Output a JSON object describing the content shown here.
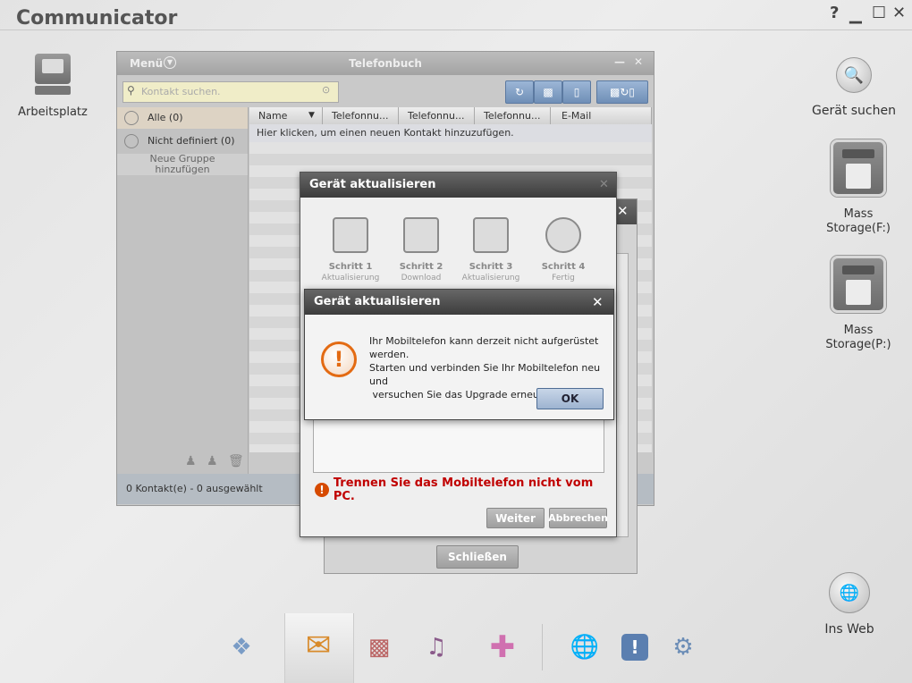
{
  "app": {
    "title": "Communicator",
    "help": "?",
    "minimize": "▁",
    "maximize": "☐",
    "close": "✕"
  },
  "desktop": {
    "left": [
      {
        "label": "Arbeitsplatz",
        "icon": "computer-icon"
      }
    ],
    "right": [
      {
        "label": "Gerät suchen",
        "icon": "search-icon"
      },
      {
        "label": "Mass\nStorage(F:)",
        "icon": "mass-storage-icon"
      },
      {
        "label": "Mass\nStorage(P:)",
        "icon": "mass-storage-icon"
      },
      {
        "label": "Ins Web",
        "icon": "globe-icon"
      }
    ]
  },
  "phonebook": {
    "menu_label": "Menü",
    "title": "Telefonbuch",
    "search_placeholder": "Kontakt suchen.",
    "groups": [
      {
        "label": "Alle (0)"
      },
      {
        "label": "Nicht definiert (0)"
      }
    ],
    "new_group": "Neue Gruppe\nhinzufügen",
    "columns": [
      "Name",
      "Telefonnu...",
      "Telefonnu...",
      "Telefonnu...",
      "E-Mail"
    ],
    "add_contact_hint": "Hier klicken, um einen neuen Kontakt hinzuzufügen.",
    "status": "0 Kontakt(e) - 0 ausgewählt"
  },
  "back_dialog": {
    "close_label": "Schließen"
  },
  "update_dialog": {
    "title": "Gerät aktualisieren",
    "steps": [
      {
        "title": "Schritt 1",
        "sub": "Aktualisierung"
      },
      {
        "title": "Schritt 2",
        "sub": "Download"
      },
      {
        "title": "Schritt 3",
        "sub": "Aktualisierung"
      },
      {
        "title": "Schritt 4",
        "sub": "Fertig"
      }
    ],
    "warning": "Trennen Sie das Mobiltelefon nicht vom PC.",
    "next_label": "Weiter",
    "cancel_label": "Abbrechen"
  },
  "error_dialog": {
    "title": "Gerät aktualisieren",
    "line1": "Ihr Mobiltelefon kann derzeit nicht aufgerüstet werden.",
    "line2": "Starten und verbinden Sie Ihr Mobiltelefon neu und",
    "line3": " versuchen Sie das Upgrade erneut.",
    "ok_label": "OK"
  },
  "dock": [
    "puzzle-icon",
    "phone-message-icon",
    "pda-icon",
    "media-icon",
    "plus-icon",
    "globe-upload-icon",
    "info-icon",
    "settings-icon"
  ]
}
